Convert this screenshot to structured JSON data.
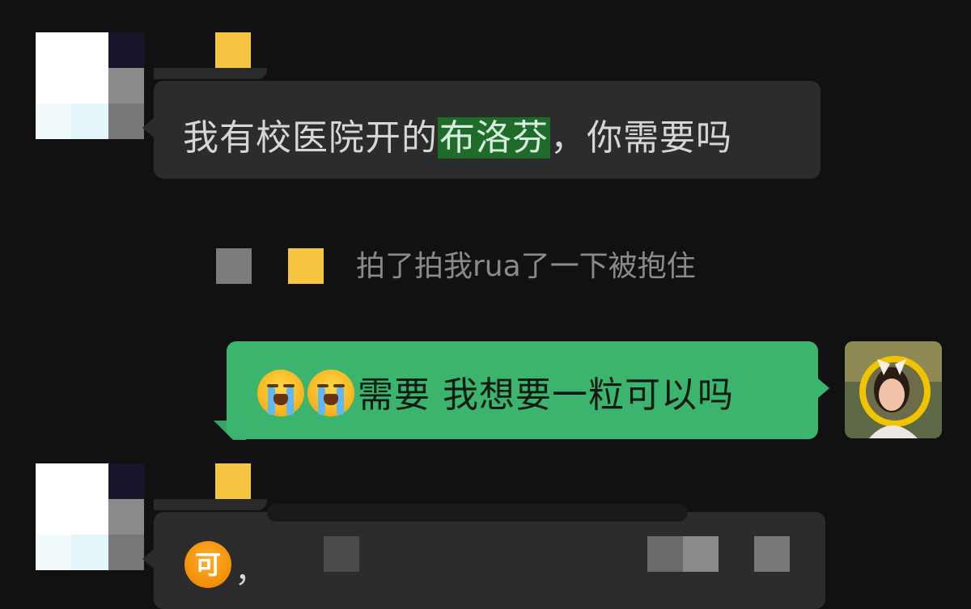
{
  "messages": {
    "first": {
      "text_before": "我有校医院开的",
      "highlight": "布洛芬",
      "text_after": "，你需要吗"
    },
    "system": {
      "text": "拍了拍我rua了一下被抱住"
    },
    "reply": {
      "emoji": "loudly-crying-face",
      "text": "需要 我想要一粒可以吗"
    },
    "third": {
      "emoji_char": "可",
      "text": "，"
    }
  },
  "colors": {
    "background": "#111111",
    "incoming_bubble": "#2c2c2c",
    "outgoing_bubble": "#3bb46e",
    "highlight": "#1f6b2a",
    "system_text": "#8a8a8a",
    "mosaic_yellow": "#f6c542"
  }
}
